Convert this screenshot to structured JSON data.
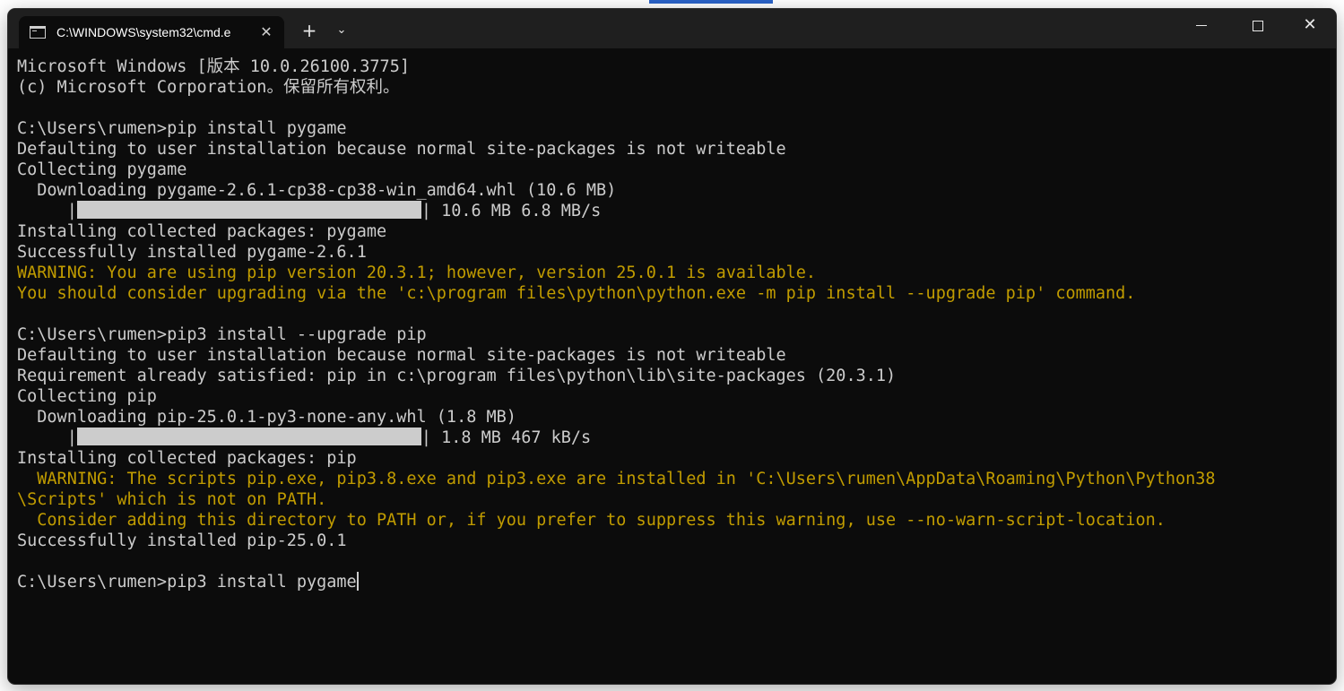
{
  "window": {
    "tab_title": "C:\\WINDOWS\\system32\\cmd.e",
    "new_tab": "+",
    "dropdown": "⌄",
    "close_tab": "✕",
    "close_window": "✕"
  },
  "terminal": {
    "lines": [
      {
        "text": "Microsoft Windows [版本 10.0.26100.3775]",
        "style": "normal"
      },
      {
        "text": "(c) Microsoft Corporation。保留所有权利。",
        "style": "normal"
      },
      {
        "text": "",
        "style": "normal"
      },
      {
        "text": "C:\\Users\\rumen>pip install pygame",
        "style": "normal"
      },
      {
        "text": "Defaulting to user installation because normal site-packages is not writeable",
        "style": "normal"
      },
      {
        "text": "Collecting pygame",
        "style": "normal"
      },
      {
        "text": "  Downloading pygame-2.6.1-cp38-cp38-win_amd64.whl (10.6 MB)",
        "style": "normal"
      },
      {
        "text": "     |",
        "style": "progress",
        "suffix": "| 10.6 MB 6.8 MB/s",
        "progress": 1.0
      },
      {
        "text": "Installing collected packages: pygame",
        "style": "normal"
      },
      {
        "text": "Successfully installed pygame-2.6.1",
        "style": "normal"
      },
      {
        "text": "WARNING: You are using pip version 20.3.1; however, version 25.0.1 is available.",
        "style": "warn"
      },
      {
        "text": "You should consider upgrading via the 'c:\\program files\\python\\python.exe -m pip install --upgrade pip' command.",
        "style": "warn"
      },
      {
        "text": "",
        "style": "normal"
      },
      {
        "text": "C:\\Users\\rumen>pip3 install --upgrade pip",
        "style": "normal"
      },
      {
        "text": "Defaulting to user installation because normal site-packages is not writeable",
        "style": "normal"
      },
      {
        "text": "Requirement already satisfied: pip in c:\\program files\\python\\lib\\site-packages (20.3.1)",
        "style": "normal"
      },
      {
        "text": "Collecting pip",
        "style": "normal"
      },
      {
        "text": "  Downloading pip-25.0.1-py3-none-any.whl (1.8 MB)",
        "style": "normal"
      },
      {
        "text": "     |",
        "style": "progress",
        "suffix": "| 1.8 MB 467 kB/s",
        "progress": 1.0
      },
      {
        "text": "Installing collected packages: pip",
        "style": "normal"
      },
      {
        "text": "  WARNING: The scripts pip.exe, pip3.8.exe and pip3.exe are installed in 'C:\\Users\\rumen\\AppData\\Roaming\\Python\\Python38",
        "style": "warn"
      },
      {
        "text": "\\Scripts' which is not on PATH.",
        "style": "warn"
      },
      {
        "text": "  Consider adding this directory to PATH or, if you prefer to suppress this warning, use --no-warn-script-location.",
        "style": "warn"
      },
      {
        "text": "Successfully installed pip-25.0.1",
        "style": "normal"
      },
      {
        "text": "",
        "style": "normal"
      },
      {
        "text": "C:\\Users\\rumen>pip3 install pygame",
        "style": "prompt"
      }
    ]
  },
  "colors": {
    "background": "#0c0c0c",
    "text": "#cccccc",
    "warning": "#c19c00",
    "titlebar": "#1f1f1f"
  }
}
